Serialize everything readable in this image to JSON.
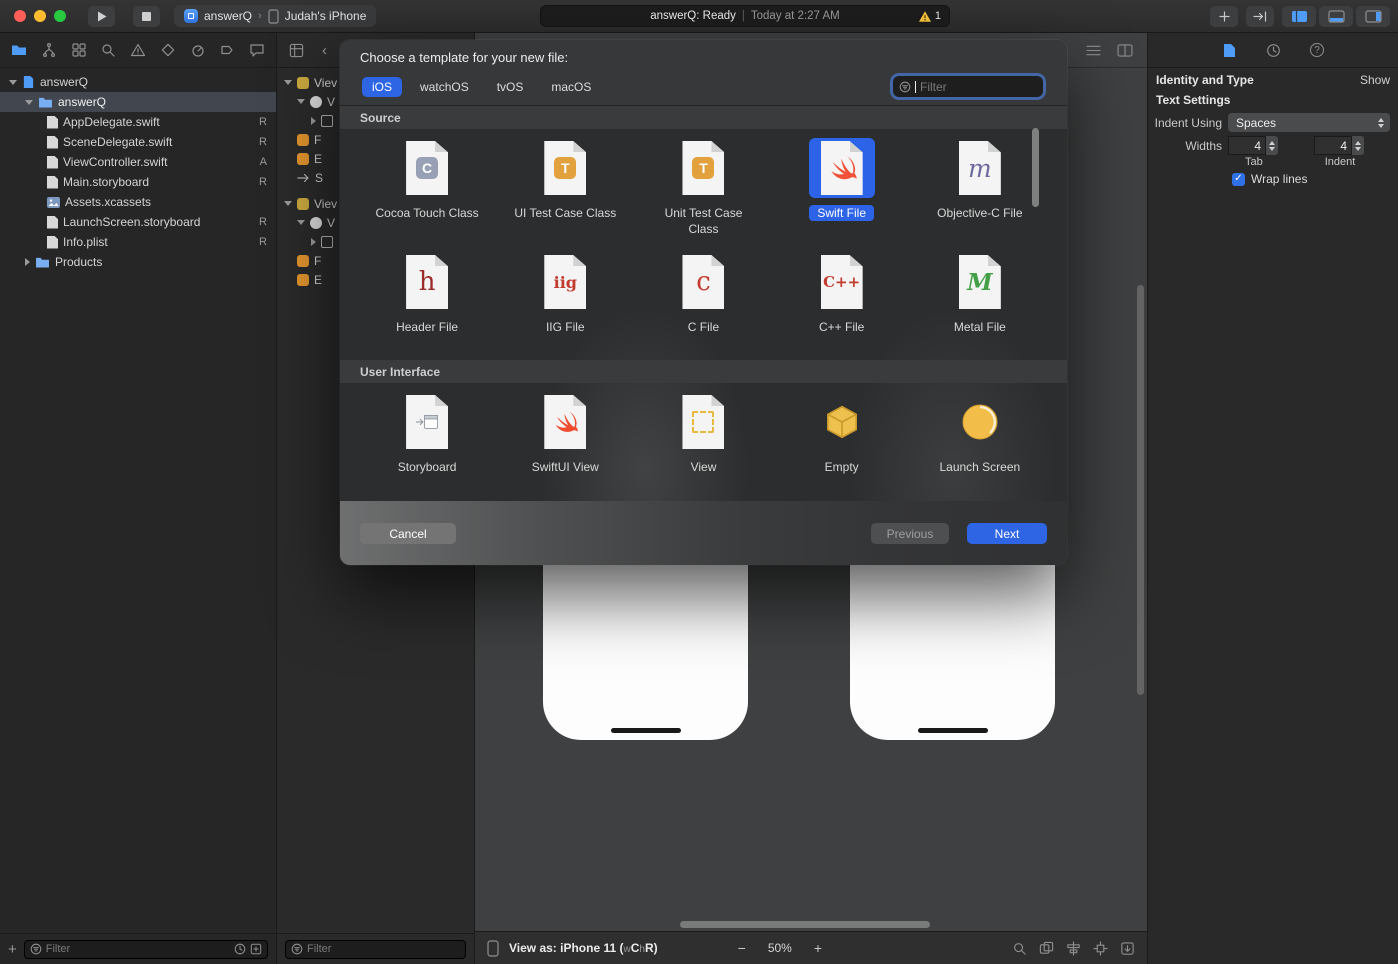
{
  "titlebar": {
    "scheme_name": "answerQ",
    "destination": "Judah's iPhone",
    "status_main": "answerQ: Ready",
    "status_sep": "|",
    "status_time": "Today at 2:27 AM",
    "warning_count": "1"
  },
  "navigator": {
    "root": "answerQ",
    "group": "answerQ",
    "files": [
      {
        "name": "AppDelegate.swift",
        "badge": "R"
      },
      {
        "name": "SceneDelegate.swift",
        "badge": "R"
      },
      {
        "name": "ViewController.swift",
        "badge": "A"
      },
      {
        "name": "Main.storyboard",
        "badge": "R"
      },
      {
        "name": "Assets.xcassets",
        "badge": ""
      },
      {
        "name": "LaunchScreen.storyboard",
        "badge": "R"
      },
      {
        "name": "Info.plist",
        "badge": "R"
      }
    ],
    "products_label": "Products",
    "add_label": "+",
    "filter_placeholder": "Filter"
  },
  "outline": {
    "items": [
      {
        "label": "Viev"
      },
      {
        "label": "V"
      },
      {
        "label": ""
      },
      {
        "label": "F"
      },
      {
        "label": "E"
      },
      {
        "label": "S"
      },
      {
        "label": "Viev"
      },
      {
        "label": "V"
      },
      {
        "label": ""
      },
      {
        "label": "F"
      },
      {
        "label": "E"
      }
    ],
    "filter_placeholder": "Filter"
  },
  "dialog": {
    "title": "Choose a template for your new file:",
    "tabs": [
      {
        "label": "iOS"
      },
      {
        "label": "watchOS"
      },
      {
        "label": "tvOS"
      },
      {
        "label": "macOS"
      }
    ],
    "filter_placeholder": "Filter",
    "icon_glyphs": {
      "cocoa": "C",
      "uitest": "T",
      "unittest": "T",
      "objc": "m",
      "header": "h",
      "iig": "iig",
      "c": "c",
      "cpp": "C++",
      "metal": "M"
    },
    "sections": [
      {
        "title": "Source",
        "items": [
          {
            "label": "Cocoa Touch Class"
          },
          {
            "label": "UI Test Case Class"
          },
          {
            "label": "Unit Test Case Class"
          },
          {
            "label": "Swift File"
          },
          {
            "label": "Objective-C File"
          },
          {
            "label": "Header File"
          },
          {
            "label": "IIG File"
          },
          {
            "label": "C File"
          },
          {
            "label": "C++ File"
          },
          {
            "label": "Metal File"
          }
        ]
      },
      {
        "title": "User Interface",
        "items": [
          {
            "label": "Storyboard"
          },
          {
            "label": "SwiftUI View"
          },
          {
            "label": "View"
          },
          {
            "label": "Empty"
          },
          {
            "label": "Launch Screen"
          }
        ]
      }
    ],
    "cancel_label": "Cancel",
    "previous_label": "Previous",
    "next_label": "Next"
  },
  "canvas": {
    "view_as_prefix": "View as: iPhone 11 (",
    "w_small": "w",
    "w_big": "C",
    "h_small": " h",
    "h_big": "R",
    "view_as_suffix": ")",
    "zoom_out": "−",
    "zoom_level": "50%",
    "zoom_in": "+"
  },
  "inspector": {
    "identity_title": "Identity and Type",
    "show_label": "Show",
    "text_settings_title": "Text Settings",
    "indent_using_label": "Indent Using",
    "indent_using_value": "Spaces",
    "widths_label": "Widths",
    "tab_width": "4",
    "indent_width": "4",
    "tab_label": "Tab",
    "indent_label": "Indent",
    "wrap_lines_label": "Wrap lines"
  }
}
